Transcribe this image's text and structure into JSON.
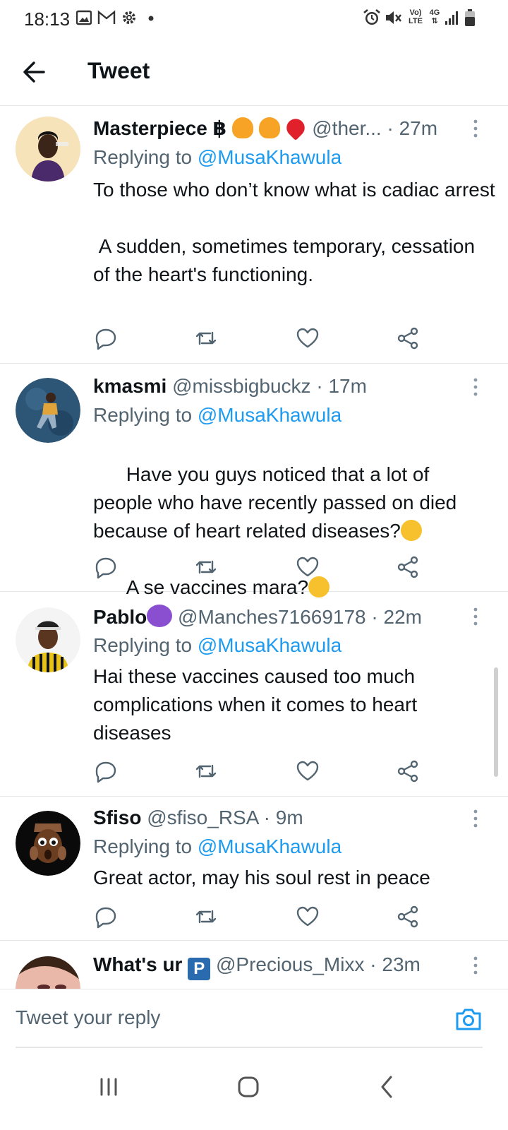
{
  "status_bar": {
    "time": "18:13",
    "left_icons": [
      "image-icon",
      "gmail-icon",
      "settings-icon",
      "dot-icon"
    ],
    "right_icons": [
      "alarm-icon",
      "mute-icon",
      "volte-icon",
      "4g-icon",
      "signal-icon",
      "battery-icon"
    ],
    "volte_label_top": "Vo)",
    "volte_label_bottom": "LTE",
    "network_label": "4G"
  },
  "header": {
    "title": "Tweet"
  },
  "tweets": [
    {
      "name": "Masterpiece ฿",
      "handle": "@ther...",
      "time": "27m",
      "replying_prefix": "Replying to ",
      "replying_to": "@MusaKhawula",
      "text": "To those who don’t know what is cadiac arrest\n\n A sudden, sometimes temporary, cessation of the heart's functioning.",
      "name_emojis": [
        "fire-emoji",
        "fire-emoji",
        "red-heart-emoji"
      ]
    },
    {
      "name": "kmasmi",
      "handle": "@missbigbuckz",
      "time": "17m",
      "replying_prefix": "Replying to ",
      "replying_to": "@MusaKhawula",
      "text_line1": "Have you guys noticed that a lot of people who have recently passed on died because of heart related diseases?",
      "text_line2": "A se vaccines mara?",
      "text_emojis": [
        "thinking-face-emoji",
        "loudly-crying-face-emoji"
      ]
    },
    {
      "name": "Pablo",
      "handle": "@Manches71669178",
      "time": "22m",
      "replying_prefix": "Replying to ",
      "replying_to": "@MusaKhawula",
      "text": "Hai these vaccines caused too much complications when it comes to heart diseases",
      "name_emojis": [
        "smiling-face-with-horns-emoji"
      ]
    },
    {
      "name": "Sfiso",
      "handle": "@sfiso_RSA",
      "time": "9m",
      "replying_prefix": "Replying to ",
      "replying_to": "@MusaKhawula",
      "text": "Great actor, may his soul rest in peace"
    },
    {
      "name": "What's ur",
      "name_badge": "P",
      "handle": "@Precious_Mixx",
      "time": "23m"
    }
  ],
  "separator": "·",
  "action_icons": [
    "reply-icon",
    "retweet-icon",
    "like-icon",
    "share-icon"
  ],
  "composer": {
    "placeholder": "Tweet your reply"
  },
  "colors": {
    "accent": "#1d9bf0",
    "secondary_text": "#536471",
    "primary_text": "#0f1419",
    "divider": "#e6e6e6"
  }
}
